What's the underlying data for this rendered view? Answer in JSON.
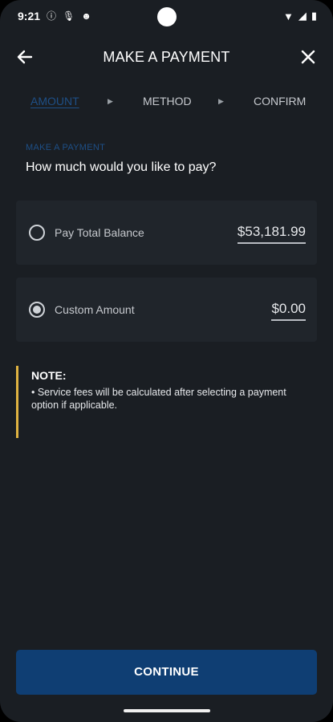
{
  "status_bar": {
    "time": "9:21",
    "icons": [
      "info-circle-icon",
      "mic-icon",
      "face-icon"
    ],
    "right_icons": [
      "wifi-icon",
      "signal-icon",
      "battery-icon"
    ]
  },
  "header": {
    "title": "MAKE A PAYMENT",
    "back_icon": "back-arrow-icon",
    "close_icon": "close-icon"
  },
  "steps": [
    {
      "label": "AMOUNT",
      "active": true
    },
    {
      "label": "METHOD",
      "active": false
    },
    {
      "label": "CONFIRM",
      "active": false
    }
  ],
  "section_label": "MAKE A PAYMENT",
  "question": "How much would you like to pay?",
  "options": [
    {
      "label": "Pay Total Balance",
      "amount": "$53,181.99",
      "selected": false
    },
    {
      "label": "Custom Amount",
      "amount": "$0.00",
      "selected": true
    }
  ],
  "note": {
    "title": "NOTE:",
    "text": "• Service fees will be calculated after selecting a payment option if applicable."
  },
  "continue_label": "CONTINUE",
  "colors": {
    "background": "#1a1e23",
    "card": "#20252b",
    "accent": "#1e4f86",
    "button": "#0f3e73",
    "note_bar": "#e0b341"
  }
}
